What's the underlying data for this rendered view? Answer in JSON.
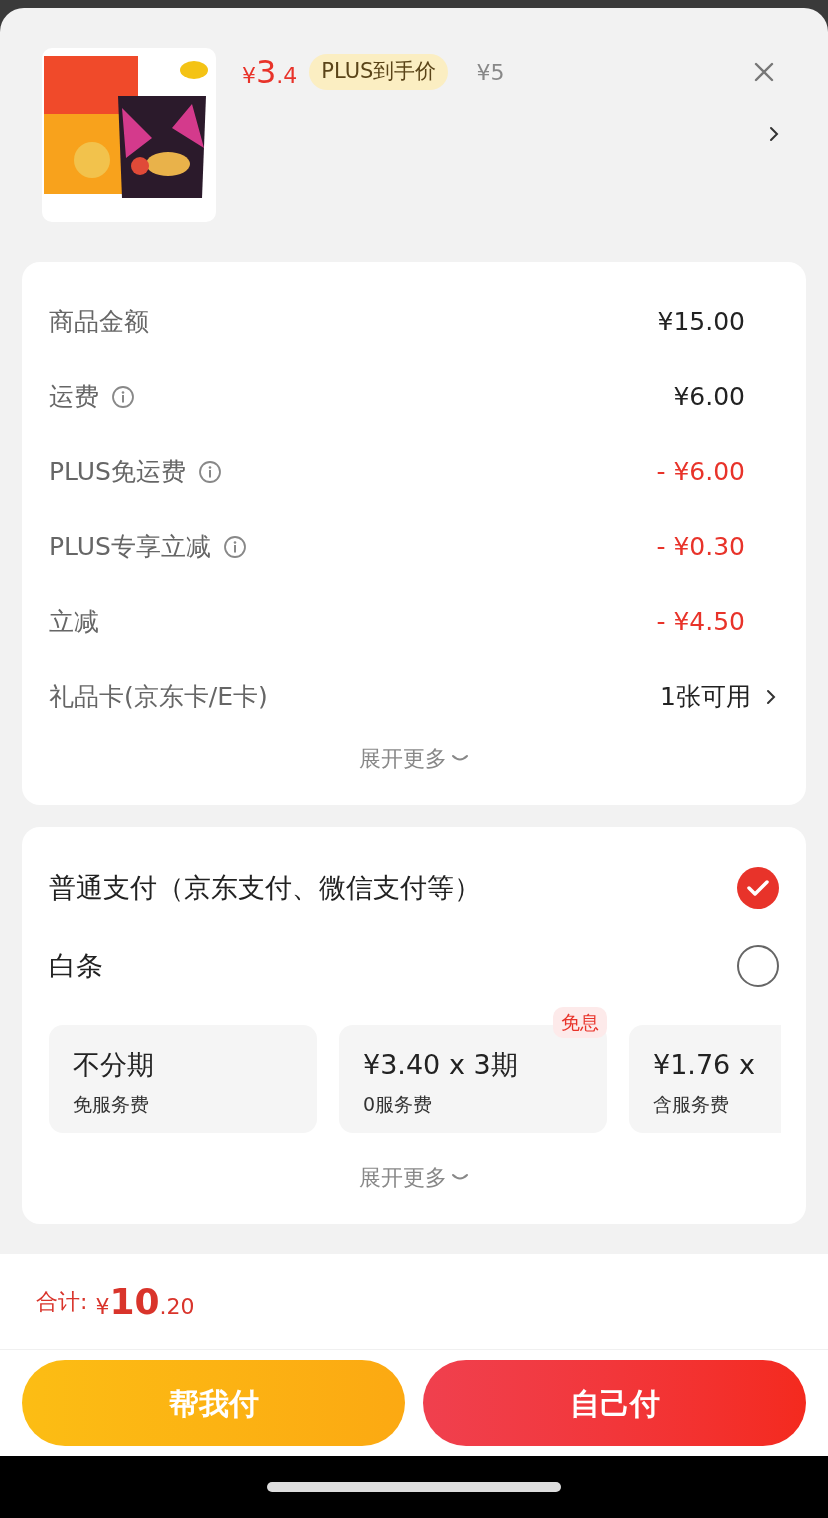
{
  "product": {
    "price": {
      "symbol": "¥",
      "integer": "3",
      "decimal": ".4"
    },
    "badge": "PLUS到手价",
    "original_price": "¥5"
  },
  "fees": [
    {
      "label": "商品金额",
      "info": false,
      "value": "¥15.00",
      "kind": "amount"
    },
    {
      "label": "运费",
      "info": true,
      "value": "¥6.00",
      "kind": "amount"
    },
    {
      "label": "PLUS免运费",
      "info": true,
      "value": "- ¥6.00",
      "kind": "discount"
    },
    {
      "label": "PLUS专享立减",
      "info": true,
      "value": "- ¥0.30",
      "kind": "discount"
    },
    {
      "label": "立减",
      "info": false,
      "value": "- ¥4.50",
      "kind": "discount"
    },
    {
      "label": "礼品卡(京东卡/E卡)",
      "info": false,
      "value": "1张可用",
      "kind": "link"
    }
  ],
  "fees_more": "展开更多",
  "payment_methods": [
    {
      "label": "普通支付（京东支付、微信支付等）",
      "selected": true
    },
    {
      "label": "白条",
      "selected": false
    }
  ],
  "installments": [
    {
      "title": "不分期",
      "subtitle": "免服务费"
    },
    {
      "title": "¥3.40 x 3期",
      "subtitle": "0服务费",
      "badge": "免息"
    },
    {
      "title": "¥1.76 x",
      "subtitle": "含服务费"
    }
  ],
  "payment_more": "展开更多",
  "total": {
    "label": "合计:",
    "symbol": "¥",
    "integer": "10",
    "decimal": ".20"
  },
  "buttons": [
    {
      "label": "帮我付",
      "kind": "secondary"
    },
    {
      "label": "自己付",
      "kind": "primary"
    }
  ]
}
